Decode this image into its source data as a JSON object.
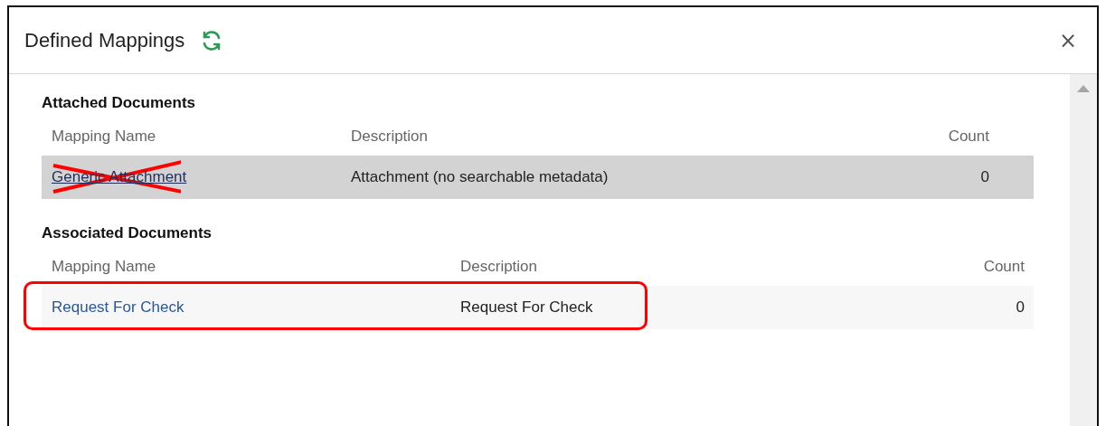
{
  "dialog": {
    "title": "Defined Mappings",
    "close": "×"
  },
  "sections": [
    {
      "title": "Attached Documents",
      "columns": [
        "Mapping Name",
        "Description",
        "Count"
      ],
      "rows": [
        {
          "name": "Generic Attachment",
          "description": "Attachment (no searchable metadata)",
          "count": "0",
          "selected": true,
          "crossed_out": true,
          "circled": false
        }
      ]
    },
    {
      "title": "Associated Documents",
      "columns": [
        "Mapping Name",
        "Description",
        "Count"
      ],
      "rows": [
        {
          "name": "Request For Check",
          "description": "Request For Check",
          "count": "0",
          "selected": false,
          "crossed_out": false,
          "circled": true
        }
      ]
    }
  ]
}
